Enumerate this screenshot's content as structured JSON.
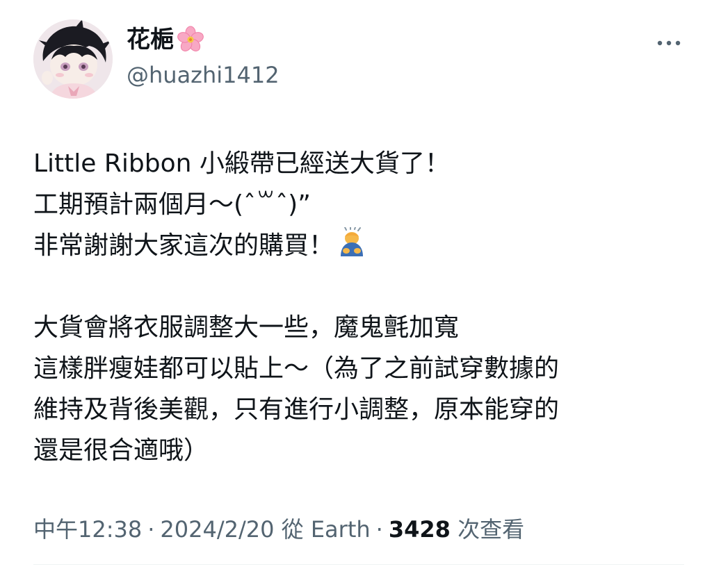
{
  "author": {
    "display_name": "花梔",
    "name_emoji": "cherry-blossom-icon",
    "handle": "@huazhi1412"
  },
  "more_icon": "more-horizontal-icon",
  "tweet": {
    "lines": [
      "Little Ribbon 小緞帶已經送大貨了！",
      "工期預計兩個月～(ˆ꒳ˆ)”",
      "非常謝謝大家這次的購買！",
      "",
      "大貨會將衣服調整大一些，魔鬼氈加寬",
      "這樣胖瘦娃都可以貼上～（為了之前試穿數據的",
      "維持及背後美觀，只有進行小調整，原本能穿的",
      "還是很合適哦）"
    ],
    "line3_emoji": "bowing-person-icon"
  },
  "meta": {
    "time": "中午12:38",
    "sep1": "·",
    "date": "2024/2/20",
    "from": "從 Earth",
    "sep2": "·",
    "views_count": "3428",
    "views_label": "次查看"
  },
  "colors": {
    "text": "#0f1419",
    "secondary": "#536471",
    "divider": "#eff3f4"
  }
}
